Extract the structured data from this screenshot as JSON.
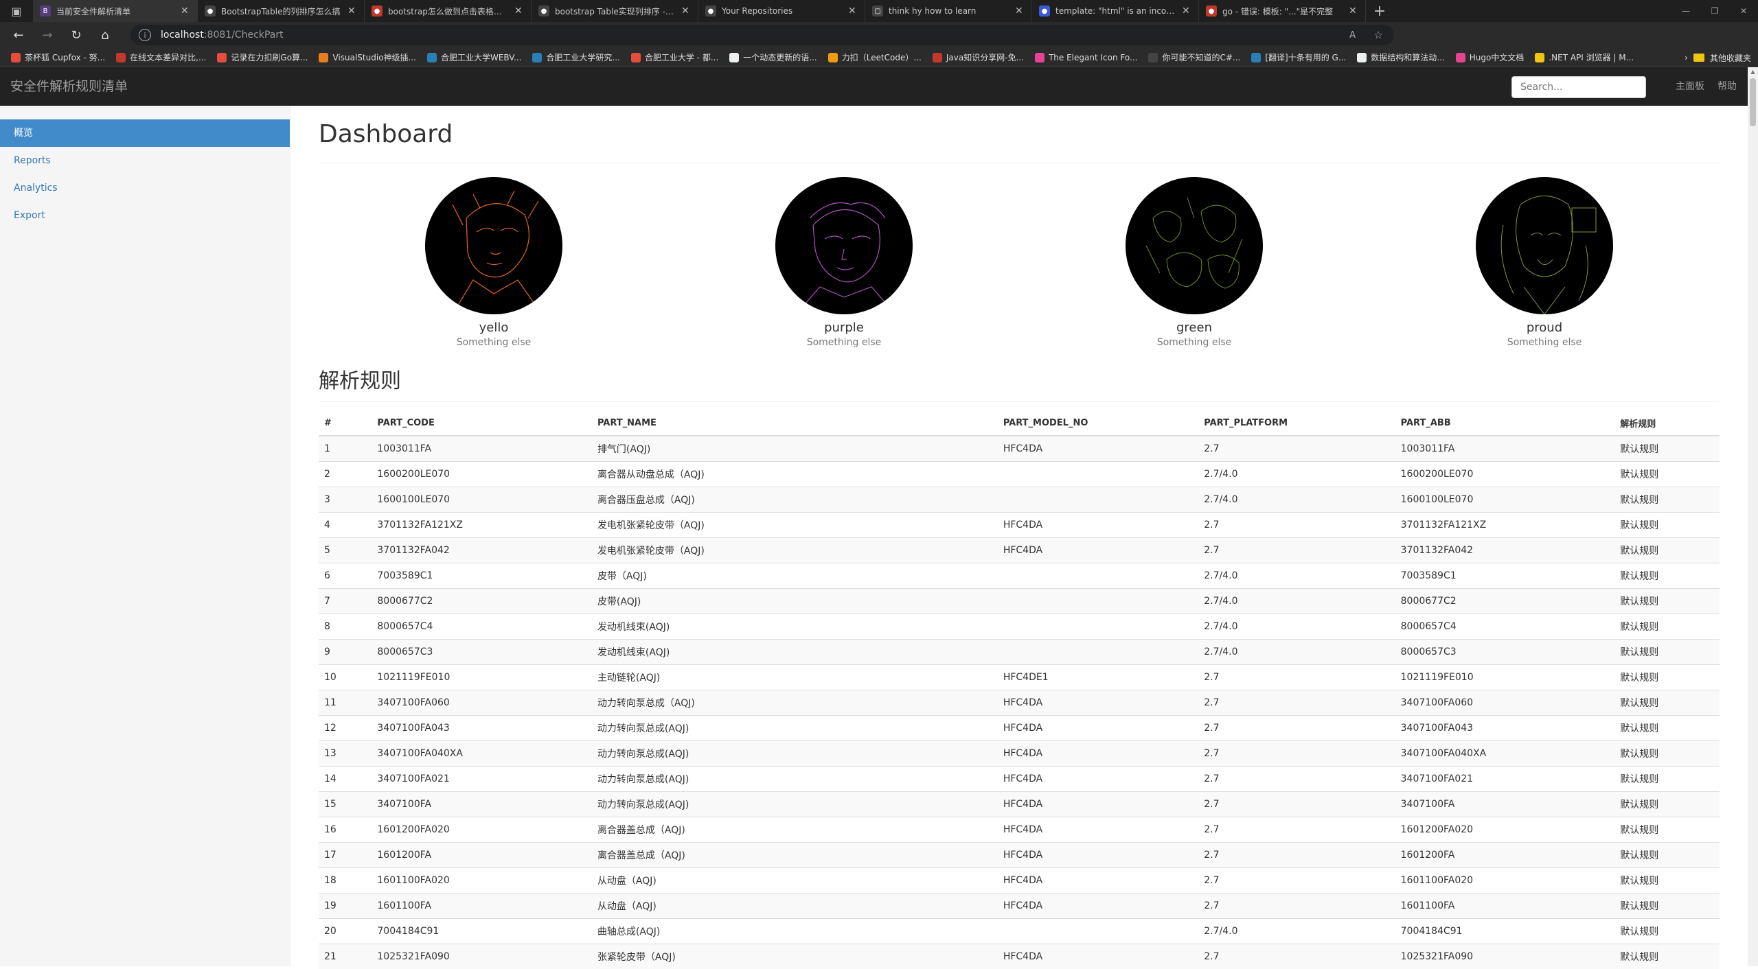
{
  "browser": {
    "tabs": [
      {
        "title": "当前安全件解析清单",
        "favicon_color": "#563d7c",
        "favicon_text": "B",
        "active": true
      },
      {
        "title": "BootstrapTable的列排序怎么搞",
        "favicon_color": "#444444",
        "favicon_text": "●"
      },
      {
        "title": "bootstrap怎么做到点击表格表头",
        "favicon_color": "#c0392b",
        "favicon_text": "●"
      },
      {
        "title": "bootstrap Table实现列排序 - anc",
        "favicon_color": "#444444",
        "favicon_text": "●"
      },
      {
        "title": "Your Repositories",
        "favicon_color": "#444444",
        "favicon_text": "●"
      },
      {
        "title": "think hy how to learn",
        "favicon_color": "#444444",
        "favicon_text": "▢"
      },
      {
        "title": "template: \"html\" is an incomplet",
        "favicon_color": "#3b5bdb",
        "favicon_text": "●"
      },
      {
        "title": "go - 错误: 模板: \"...\"是不完整",
        "favicon_color": "#c0392b",
        "favicon_text": "●"
      }
    ],
    "new_tab_label": "+",
    "url_host": "localhost",
    "url_path": ":8081/CheckPart",
    "bookmarks": [
      {
        "label": "茶杯狐 Cupfox - 努...",
        "color": "#e74c3c"
      },
      {
        "label": "在线文本差异对比,...",
        "color": "#c0392b"
      },
      {
        "label": "记录在力扣刷Go算...",
        "color": "#e74c3c"
      },
      {
        "label": "VisualStudio神级插...",
        "color": "#e67e22"
      },
      {
        "label": "合肥工业大学WEBV...",
        "color": "#2980b9"
      },
      {
        "label": "合肥工业大学研究...",
        "color": "#2980b9"
      },
      {
        "label": "合肥工业大学 - 都...",
        "color": "#e74c3c"
      },
      {
        "label": "一个动态更新的语...",
        "color": "#ecf0f1"
      },
      {
        "label": "力扣（LeetCode）...",
        "color": "#f39c12"
      },
      {
        "label": "Java知识分享网-免...",
        "color": "#c0392b"
      },
      {
        "label": "The Elegant Icon Fo...",
        "color": "#e84393"
      },
      {
        "label": "你可能不知道的C#...",
        "color": "#444444"
      },
      {
        "label": "[翻译]十条有用的 G...",
        "color": "#2980b9"
      },
      {
        "label": "数据结构和算法动...",
        "color": "#ecf0f1"
      },
      {
        "label": "Hugo中文文档",
        "color": "#e84393"
      },
      {
        "label": ".NET API 浏览器 | M...",
        "color": "#f1c40f"
      }
    ],
    "other_bookmarks": "其他收藏夹"
  },
  "navbar": {
    "brand": "安全件解析规则清单",
    "search_placeholder": "Search...",
    "links": [
      "主面板",
      "帮助"
    ]
  },
  "sidebar": {
    "items": [
      {
        "label": "概览",
        "active": true
      },
      {
        "label": "Reports"
      },
      {
        "label": "Analytics"
      },
      {
        "label": "Export"
      }
    ]
  },
  "main": {
    "title": "Dashboard",
    "placeholders": [
      {
        "name": "yello",
        "sub": "Something else",
        "line_color": "#e8641a"
      },
      {
        "name": "purple",
        "sub": "Something else",
        "line_color": "#b04fc2"
      },
      {
        "name": "green",
        "sub": "Something else",
        "line_color": "#6b8e23"
      },
      {
        "name": "proud",
        "sub": "Something else",
        "line_color": "#7f9a3a"
      }
    ],
    "table_title": "解析规则",
    "table": {
      "headers": [
        "#",
        "PART_CODE",
        "PART_NAME",
        "PART_MODEL_NO",
        "PART_PLATFORM",
        "PART_ABB",
        "解析规则"
      ],
      "rows": [
        [
          "1",
          "1003011FA",
          "排气门(AQJ)",
          "HFC4DA",
          "2.7",
          "1003011FA",
          "默认规则"
        ],
        [
          "2",
          "1600200LE070",
          "离合器从动盘总成（AQJ)",
          "",
          "2.7/4.0",
          "1600200LE070",
          "默认规则"
        ],
        [
          "3",
          "1600100LE070",
          "离合器压盘总成（AQJ)",
          "",
          "2.7/4.0",
          "1600100LE070",
          "默认规则"
        ],
        [
          "4",
          "3701132FA121XZ",
          "发电机张紧轮皮带（AQJ)",
          "HFC4DA",
          "2.7",
          "3701132FA121XZ",
          "默认规则"
        ],
        [
          "5",
          "3701132FA042",
          "发电机张紧轮皮带（AQJ)",
          "HFC4DA",
          "2.7",
          "3701132FA042",
          "默认规则"
        ],
        [
          "6",
          "7003589C1",
          "皮带（AQJ)",
          "",
          "2.7/4.0",
          "7003589C1",
          "默认规则"
        ],
        [
          "7",
          "8000677C2",
          "皮带(AQJ)",
          "",
          "2.7/4.0",
          "8000677C2",
          "默认规则"
        ],
        [
          "8",
          "8000657C4",
          "发动机线束(AQJ)",
          "",
          "2.7/4.0",
          "8000657C4",
          "默认规则"
        ],
        [
          "9",
          "8000657C3",
          "发动机线束(AQJ)",
          "",
          "2.7/4.0",
          "8000657C3",
          "默认规则"
        ],
        [
          "10",
          "1021119FE010",
          "主动链轮(AQJ)",
          "HFC4DE1",
          "2.7",
          "1021119FE010",
          "默认规则"
        ],
        [
          "11",
          "3407100FA060",
          "动力转向泵总成（AQJ)",
          "HFC4DA",
          "2.7",
          "3407100FA060",
          "默认规则"
        ],
        [
          "12",
          "3407100FA043",
          "动力转向泵总成(AQJ)",
          "HFC4DA",
          "2.7",
          "3407100FA043",
          "默认规则"
        ],
        [
          "13",
          "3407100FA040XA",
          "动力转向泵总成(AQJ)",
          "HFC4DA",
          "2.7",
          "3407100FA040XA",
          "默认规则"
        ],
        [
          "14",
          "3407100FA021",
          "动力转向泵总成(AQJ)",
          "HFC4DA",
          "2.7",
          "3407100FA021",
          "默认规则"
        ],
        [
          "15",
          "3407100FA",
          "动力转向泵总成(AQJ)",
          "HFC4DA",
          "2.7",
          "3407100FA",
          "默认规则"
        ],
        [
          "16",
          "1601200FA020",
          "离合器盖总成（AQJ)",
          "HFC4DA",
          "2.7",
          "1601200FA020",
          "默认规则"
        ],
        [
          "17",
          "1601200FA",
          "离合器盖总成（AQJ)",
          "HFC4DA",
          "2.7",
          "1601200FA",
          "默认规则"
        ],
        [
          "18",
          "1601100FA020",
          "从动盘（AQJ)",
          "HFC4DA",
          "2.7",
          "1601100FA020",
          "默认规则"
        ],
        [
          "19",
          "1601100FA",
          "从动盘（AQJ)",
          "HFC4DA",
          "2.7",
          "1601100FA",
          "默认规则"
        ],
        [
          "20",
          "7004184C91",
          "曲轴总成(AQJ)",
          "",
          "2.7/4.0",
          "7004184C91",
          "默认规则"
        ],
        [
          "21",
          "1025321FA090",
          "张紧轮皮带（AQJ)",
          "HFC4DA",
          "2.7",
          "1025321FA090",
          "默认规则"
        ]
      ]
    }
  }
}
